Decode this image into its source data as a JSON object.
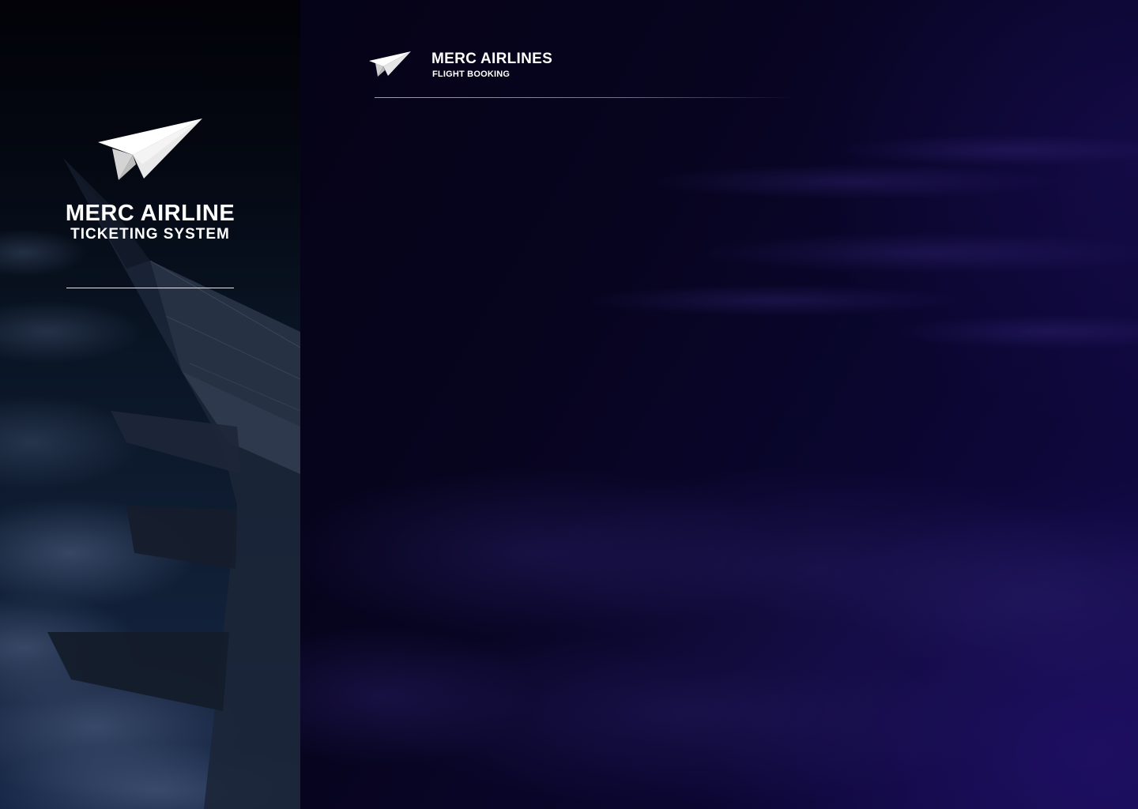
{
  "sidebar": {
    "brand_title": "MERC AIRLINE",
    "brand_subtitle": "TICKETING SYSTEM",
    "logo_icon": "paper-plane-icon"
  },
  "header": {
    "title": "MERC AIRLINES",
    "subtitle": "FLIGHT BOOKING",
    "logo_icon": "paper-plane-icon"
  },
  "colors": {
    "sidebar_bg": "#0a1626",
    "main_bg": "#07041f",
    "accent_purple": "#130a4a",
    "text": "#ffffff"
  }
}
